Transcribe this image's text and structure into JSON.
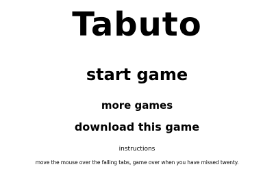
{
  "game": {
    "title": "Tabuto"
  },
  "menu": {
    "start_label": "start game",
    "more_label": "more games",
    "download_label": "download this game"
  },
  "instructions": {
    "heading": "instructions",
    "text": "move the mouse over the falling tabs, game over when you have missed twenty."
  }
}
